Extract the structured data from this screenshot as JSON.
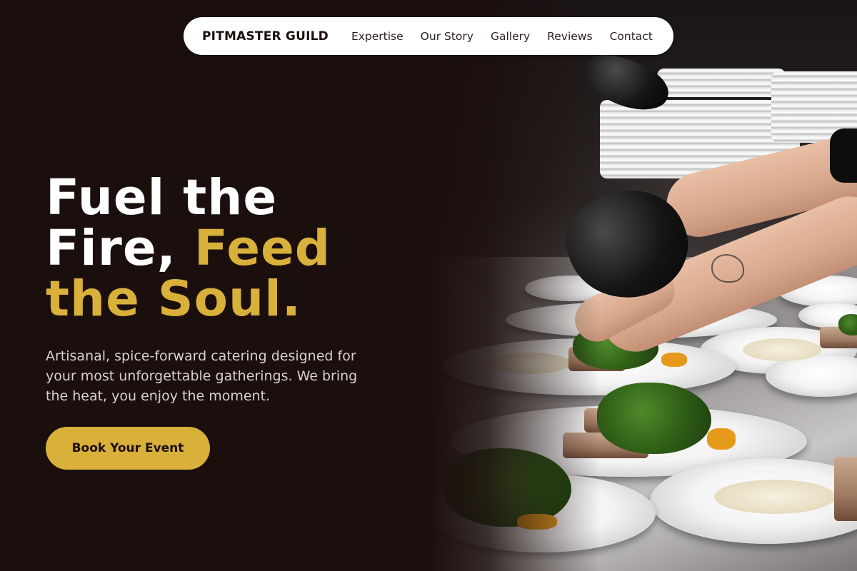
{
  "nav": {
    "brand": "PITMASTER GUILD",
    "links": [
      "Expertise",
      "Our Story",
      "Gallery",
      "Reviews",
      "Contact"
    ]
  },
  "hero": {
    "headline_white": "Fuel the Fire,",
    "headline_gold_1": "Feed",
    "headline_gold_2": "the Soul.",
    "subtitle": "Artisanal, spice-forward catering designed for your most unforgettable gatherings. We bring the heat, you enjoy the moment.",
    "cta_label": "Book Your Event"
  },
  "image": {
    "subject": "chef-plating-dishes-photo"
  },
  "colors": {
    "background": "#1b0f0e",
    "accent_gold": "#d9b03a",
    "nav_background": "#ffffff",
    "text_light": "#d8d0cf"
  }
}
